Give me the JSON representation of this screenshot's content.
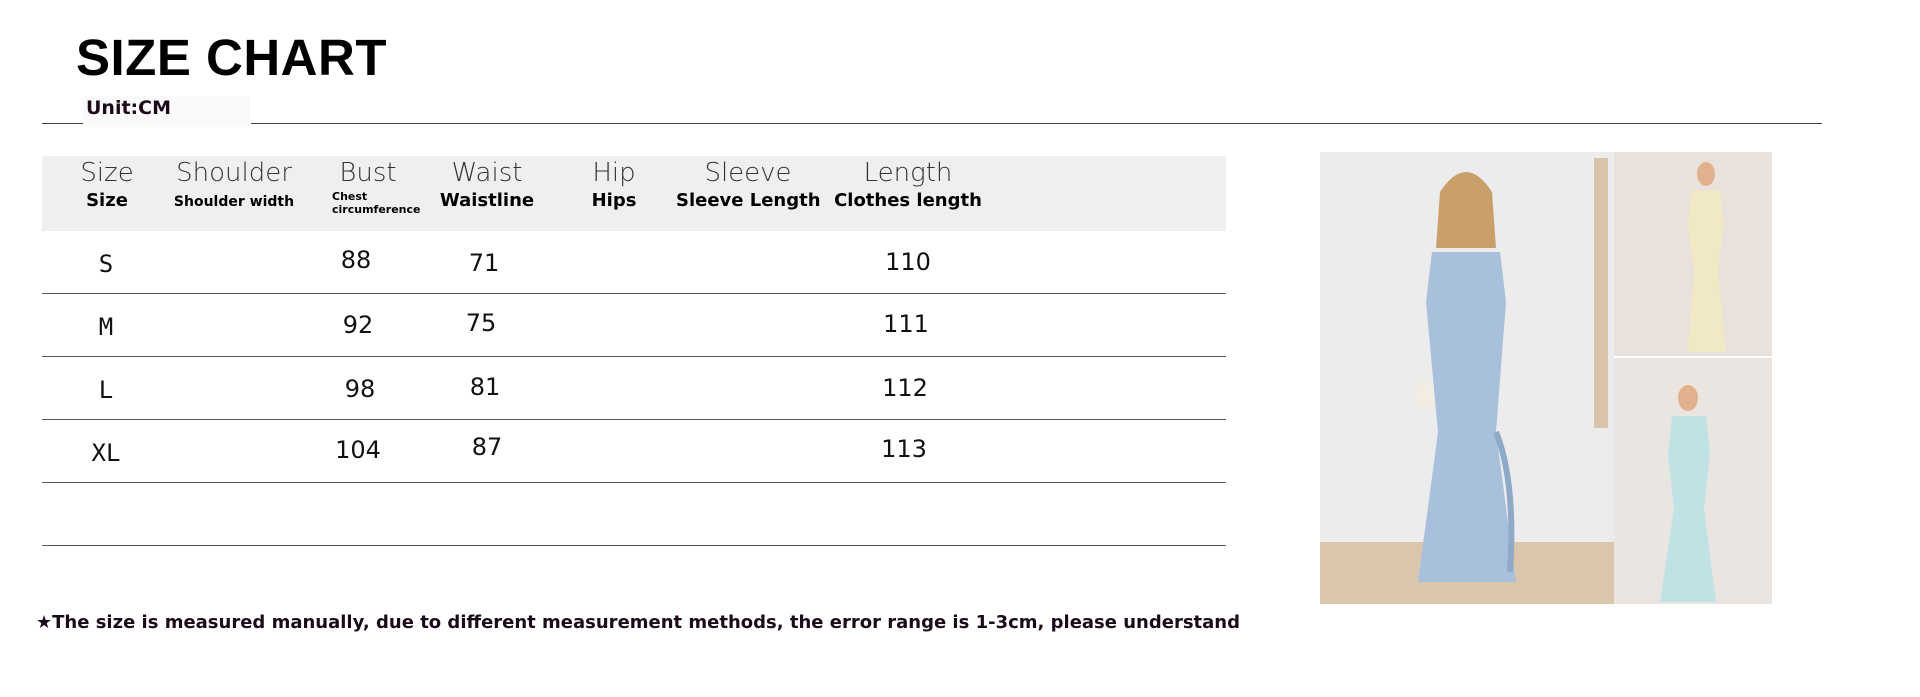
{
  "title": "SIZE CHART",
  "unit": "Unit:CM",
  "columns": [
    {
      "top": "Size",
      "bottom": "Size"
    },
    {
      "top": "Shoulder",
      "bottom": "Shoulder width"
    },
    {
      "top": "Bust",
      "bottom": "Chest circumference"
    },
    {
      "top": "Waist",
      "bottom": "Waistline"
    },
    {
      "top": "Hip",
      "bottom": "Hips"
    },
    {
      "top": "Sleeve",
      "bottom": "Sleeve Length"
    },
    {
      "top": "Length",
      "bottom": "Clothes length"
    }
  ],
  "rows": [
    {
      "size": "S",
      "bust": "88",
      "waist": "71",
      "length": "110"
    },
    {
      "size": "M",
      "bust": "92",
      "waist": "75",
      "length": "111"
    },
    {
      "size": "L",
      "bust": "98",
      "waist": "81",
      "length": "112"
    },
    {
      "size": "XL",
      "bust": "104",
      "waist": "87",
      "length": "113"
    }
  ],
  "note": "★The size is measured manually, due to different measurement methods, the error range is 1-3cm, please understand",
  "photos": [
    {
      "name": "blue-dress-photo",
      "dress_color": "#a9c0dc",
      "bg_color": "#ececec"
    },
    {
      "name": "cream-dress-photo",
      "dress_color": "#f1e8c4",
      "bg_color": "#e9e2dc"
    },
    {
      "name": "mint-dress-photo",
      "dress_color": "#bfe3e4",
      "bg_color": "#ebe5e1"
    }
  ]
}
